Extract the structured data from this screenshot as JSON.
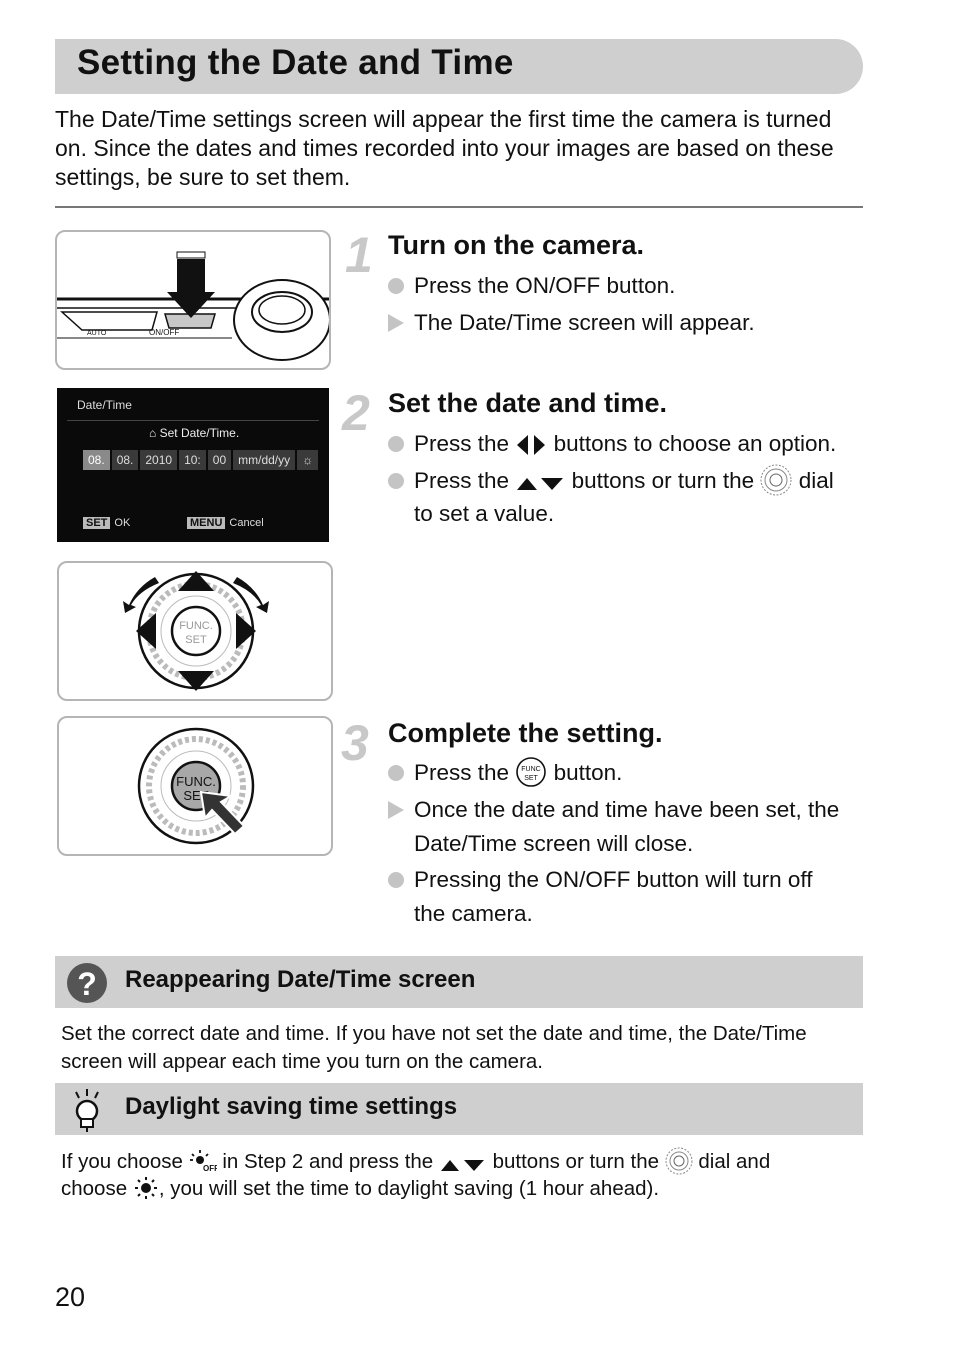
{
  "page": {
    "title": "Setting the Date and Time",
    "intro": "The Date/Time settings screen will appear the first time the camera is turned on. Since the dates and times recorded into your images are based on these settings, be sure to set them.",
    "page_number": "20"
  },
  "illustrations": {
    "camera_top": {
      "label": "ON/OFF",
      "mode_label": "AUTO",
      "icon": "down-arrow-icon"
    },
    "date_screen": {
      "title": "Date/Time",
      "heading": "Set Date/Time.",
      "fields": [
        "08.",
        "08.",
        "2010",
        "10:",
        "00",
        "mm/dd/yy"
      ],
      "selected_index": 0,
      "dst_icon": "dst-off-icon",
      "ok_badge": "SET",
      "ok_label": "OK",
      "cancel_badge": "MENU",
      "cancel_label": "Cancel"
    },
    "control_dial": {
      "button_line1": "FUNC.",
      "button_line2": "SET"
    },
    "func_press": {
      "button_line1": "FUNC.",
      "button_line2": "SET"
    }
  },
  "steps": [
    {
      "number": "1",
      "title": "Turn on the camera.",
      "items": [
        {
          "type": "action",
          "text": "Press the ON/OFF button."
        },
        {
          "type": "result",
          "text": "The Date/Time screen will appear."
        }
      ]
    },
    {
      "number": "2",
      "title": "Set the date and time.",
      "items": [
        {
          "type": "action",
          "pre": "Press the",
          "icon": "left-right-arrows-icon",
          "post": "buttons to choose an option."
        },
        {
          "type": "action",
          "pre": "Press the",
          "icon": "up-down-arrows-icon",
          "mid": "buttons or turn the",
          "icon2": "control-dial-icon",
          "post": "dial",
          "cont": "to set a value."
        }
      ]
    },
    {
      "number": "3",
      "title": "Complete the setting.",
      "items": [
        {
          "type": "action",
          "pre": "Press the",
          "icon": "func-set-icon",
          "post": "button."
        },
        {
          "type": "result",
          "text": "Once the date and time have been set, the",
          "cont": "Date/Time screen will close."
        },
        {
          "type": "action",
          "text": "Pressing the ON/OFF button will turn off",
          "cont": "the camera."
        }
      ]
    }
  ],
  "notes": [
    {
      "icon": "question-icon",
      "title": "Reappearing Date/Time screen",
      "text": "Set the correct date and time. If you have not set the date and time, the Date/Time screen will appear each time you turn on the camera."
    },
    {
      "icon": "lightbulb-icon",
      "title": "Daylight saving time settings",
      "line1_pre": "If you choose",
      "line1_mid": "in Step 2 and press the",
      "line1_mid2": "buttons or turn the",
      "line1_post": "dial and",
      "line2_pre": "choose",
      "line2_post": ", you will set the time to daylight saving (1 hour ahead)."
    }
  ],
  "colors": {
    "banner": "#cfcfcf",
    "step_number": "#c8c8c8",
    "bullet": "#c4c4c4",
    "screen_bg": "#0a0a0a"
  }
}
